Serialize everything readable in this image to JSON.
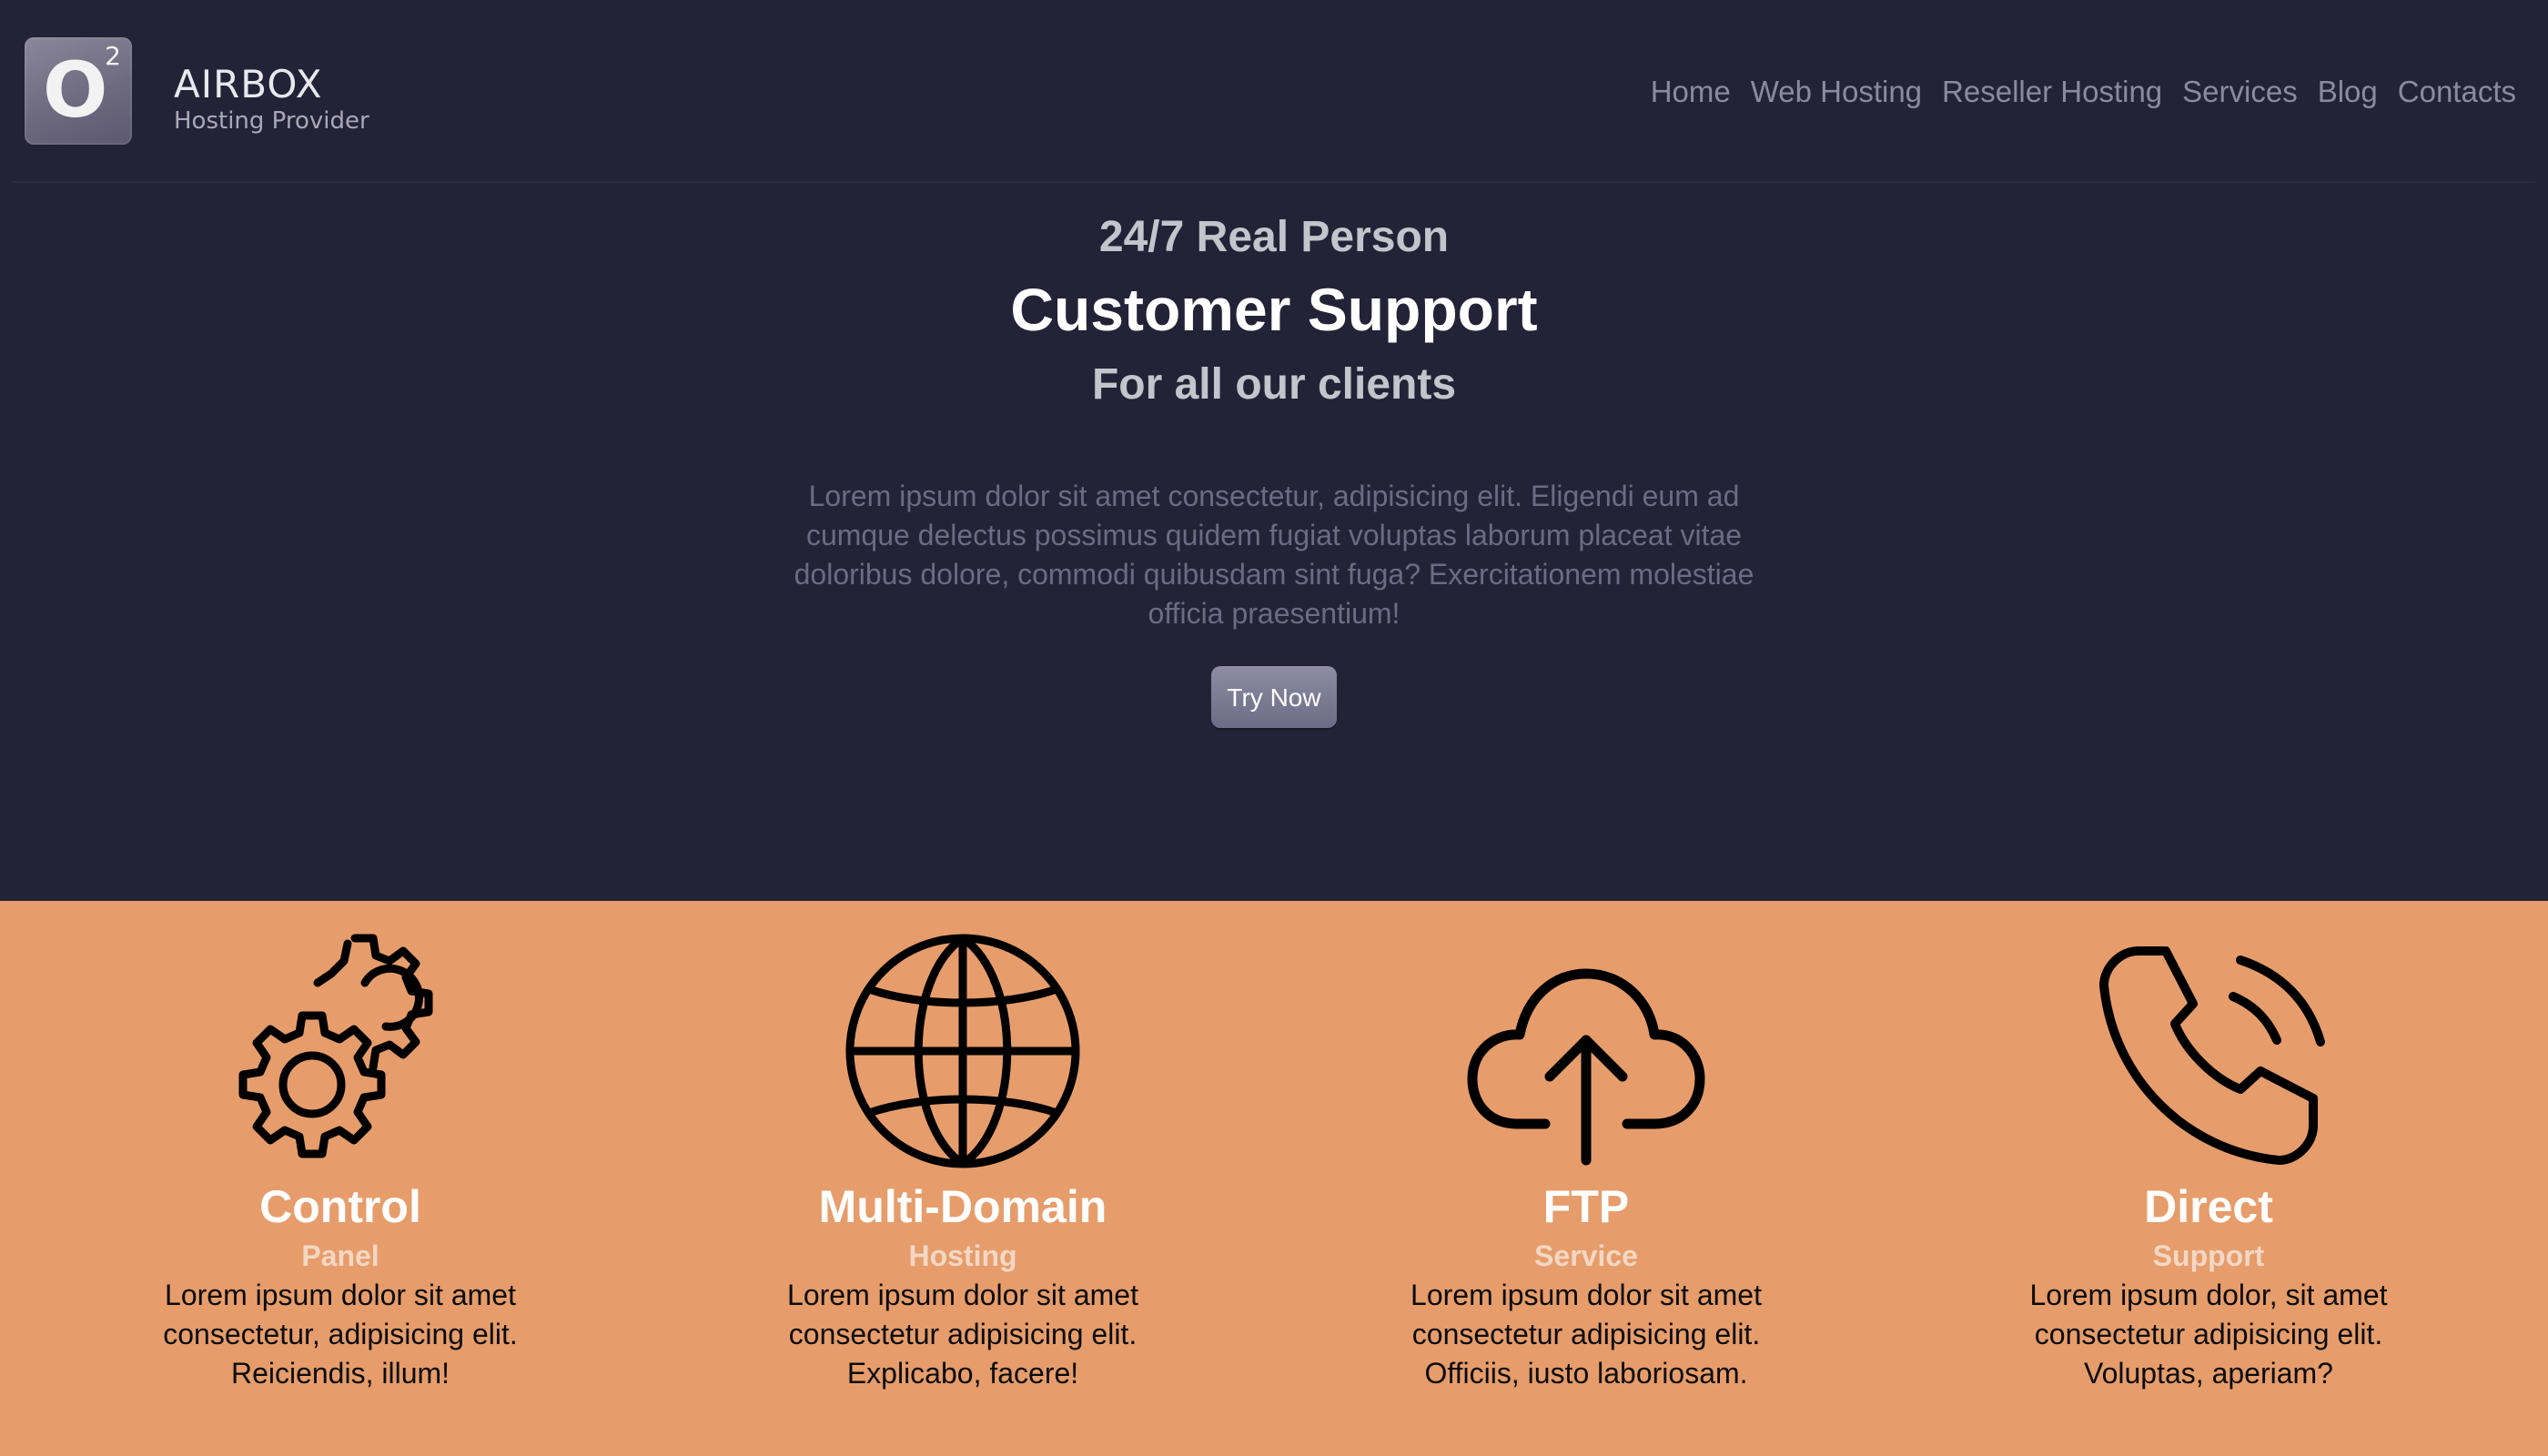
{
  "brand": {
    "logo_letter": "O",
    "logo_superscript": "2",
    "name": "AIRBOX",
    "tagline": "Hosting Provider"
  },
  "nav": {
    "items": [
      {
        "label": "Home"
      },
      {
        "label": "Web Hosting"
      },
      {
        "label": "Reseller Hosting"
      },
      {
        "label": "Services"
      },
      {
        "label": "Blog"
      },
      {
        "label": "Contacts"
      }
    ]
  },
  "hero": {
    "kicker": "24/7 Real Person",
    "title": "Customer Support",
    "subtitle": "For all our clients",
    "body": "Lorem ipsum dolor sit amet consectetur, adipisicing elit. Eligendi eum ad cumque delectus possimus quidem fugiat voluptas laborum placeat vitae doloribus dolore, commodi quibusdam sint fuga? Exercitationem molestiae officia praesentium!",
    "cta_label": "Try Now"
  },
  "features": [
    {
      "icon": "gears-icon",
      "title": "Control",
      "subtitle": "Panel",
      "text": "Lorem ipsum dolor sit amet consectetur, adipisicing elit. Reiciendis, illum!"
    },
    {
      "icon": "globe-icon",
      "title": "Multi-Domain",
      "subtitle": "Hosting",
      "text": "Lorem ipsum dolor sit amet consectetur adipisicing elit. Explicabo, facere!"
    },
    {
      "icon": "cloud-upload-icon",
      "title": "FTP",
      "subtitle": "Service",
      "text": "Lorem ipsum dolor sit amet consectetur adipisicing elit. Officiis, iusto laboriosam."
    },
    {
      "icon": "phone-call-icon",
      "title": "Direct",
      "subtitle": "Support",
      "text": "Lorem ipsum dolor, sit amet consectetur adipisicing elit. Voluptas, aperiam?"
    }
  ],
  "colors": {
    "header_bg": "#242236",
    "features_bg": "#e69d6b",
    "nav_text": "#8c8aa0",
    "button_bg": "#7d7a94"
  }
}
